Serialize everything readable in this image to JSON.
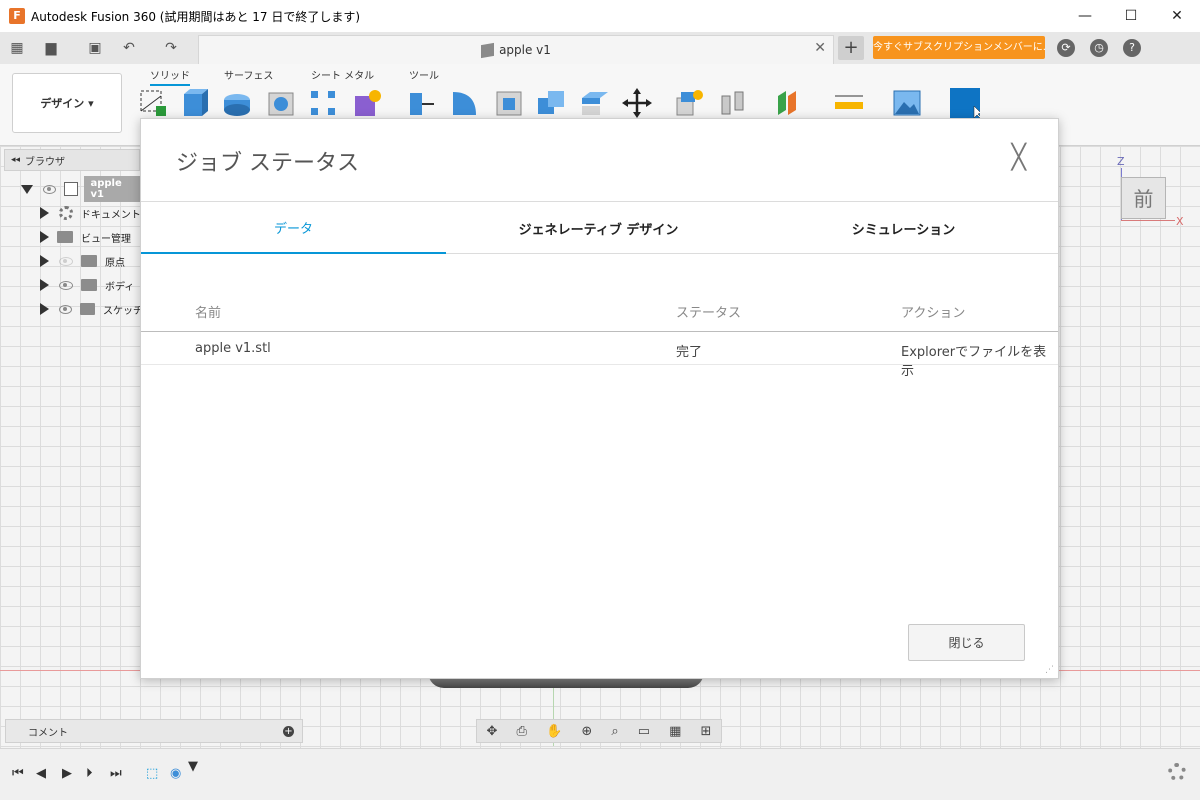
{
  "window": {
    "title": "Autodesk Fusion 360 (試用期間はあと 17 日で終了します)",
    "logo_letter": "F",
    "minimize": "—",
    "maximize": "☐",
    "close": "✕"
  },
  "app_toolbar": {
    "doc_tab_label": "apple v1",
    "doc_tab_close": "✕",
    "new_tab": "+",
    "subscription_label": "今すぐサブスクリプションメンバーに...",
    "icons": [
      "apps-grid-icon",
      "file-icon",
      "save-icon",
      "undo-icon",
      "redo-icon",
      "job-status-icon",
      "clock-icon",
      "help-icon"
    ]
  },
  "ribbon": {
    "workspace_label": "デザイン ▾",
    "tabs": [
      {
        "label": "ソリッド",
        "active": true
      },
      {
        "label": "サーフェス",
        "active": false
      },
      {
        "label": "シート メタル",
        "active": false
      },
      {
        "label": "ツール",
        "active": false
      }
    ]
  },
  "browser": {
    "header": "ブラウザ",
    "collapse_icon": "◂◂",
    "root_label": "apple v1",
    "items": [
      {
        "label": "ドキュメント"
      },
      {
        "label": "ビュー管理"
      },
      {
        "label": "原点"
      },
      {
        "label": "ボディ"
      },
      {
        "label": "スケッチ"
      }
    ]
  },
  "viewcube": {
    "face": "前",
    "z": "Z",
    "x": "X"
  },
  "comment_bar": {
    "label": "コメント",
    "add": "+"
  },
  "nav_bar": {
    "icons": [
      "orbit-icon",
      "look-at-icon",
      "pan-icon",
      "zoom-icon",
      "fit-icon",
      "display-icon",
      "grid-icon",
      "viewports-icon"
    ]
  },
  "dialog": {
    "title": "ジョブ ステータス",
    "close_glyph": "╳",
    "tabs": [
      {
        "label": "データ",
        "active": true
      },
      {
        "label": "ジェネレーティブ デザイン",
        "active": false
      },
      {
        "label": "シミュレーション",
        "active": false
      }
    ],
    "columns": {
      "name": "名前",
      "status": "ステータス",
      "action": "アクション"
    },
    "rows": [
      {
        "name": "apple v1.stl",
        "status": "完了",
        "action": "Explorerでファイルを表示"
      }
    ],
    "close_button": "閉じる"
  },
  "colors": {
    "accent": "#0696d7",
    "subscription": "#f7941e"
  }
}
